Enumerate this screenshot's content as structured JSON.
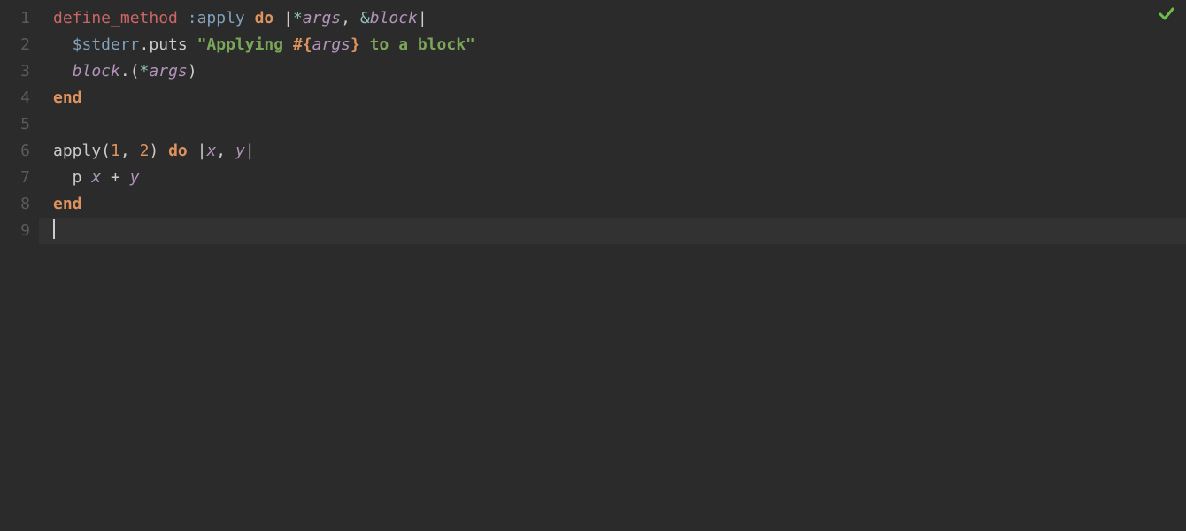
{
  "gutter": {
    "lines": [
      "1",
      "2",
      "3",
      "4",
      "5",
      "6",
      "7",
      "8",
      "9"
    ]
  },
  "code": {
    "l1": {
      "t1": "define_method",
      "t2": " :apply",
      "t3": " do",
      "t4": " |",
      "t5": "*",
      "t6": "args",
      "t7": ", ",
      "t8": "&",
      "t9": "block",
      "t10": "|"
    },
    "l2": {
      "t1": "  $stderr",
      "t2": ".puts",
      "t3": " \"Applying ",
      "t4": "#{",
      "t5": "args",
      "t6": "}",
      "t7": " to a block\""
    },
    "l3": {
      "t1": "  block",
      "t2": ".(",
      "t3": "*",
      "t4": "args",
      "t5": ")"
    },
    "l4": {
      "t1": "end"
    },
    "l5": {
      "t1": ""
    },
    "l6": {
      "t1": "apply(",
      "t2": "1",
      "t3": ", ",
      "t4": "2",
      "t5": ")",
      "t6": " do",
      "t7": " |",
      "t8": "x",
      "t9": ", ",
      "t10": "y",
      "t11": "|"
    },
    "l7": {
      "t1": "  p ",
      "t2": "x",
      "t3": " + ",
      "t4": "y"
    },
    "l8": {
      "t1": "end"
    },
    "l9": {
      "t1": ""
    }
  },
  "status": {
    "icon": "checkmark"
  }
}
